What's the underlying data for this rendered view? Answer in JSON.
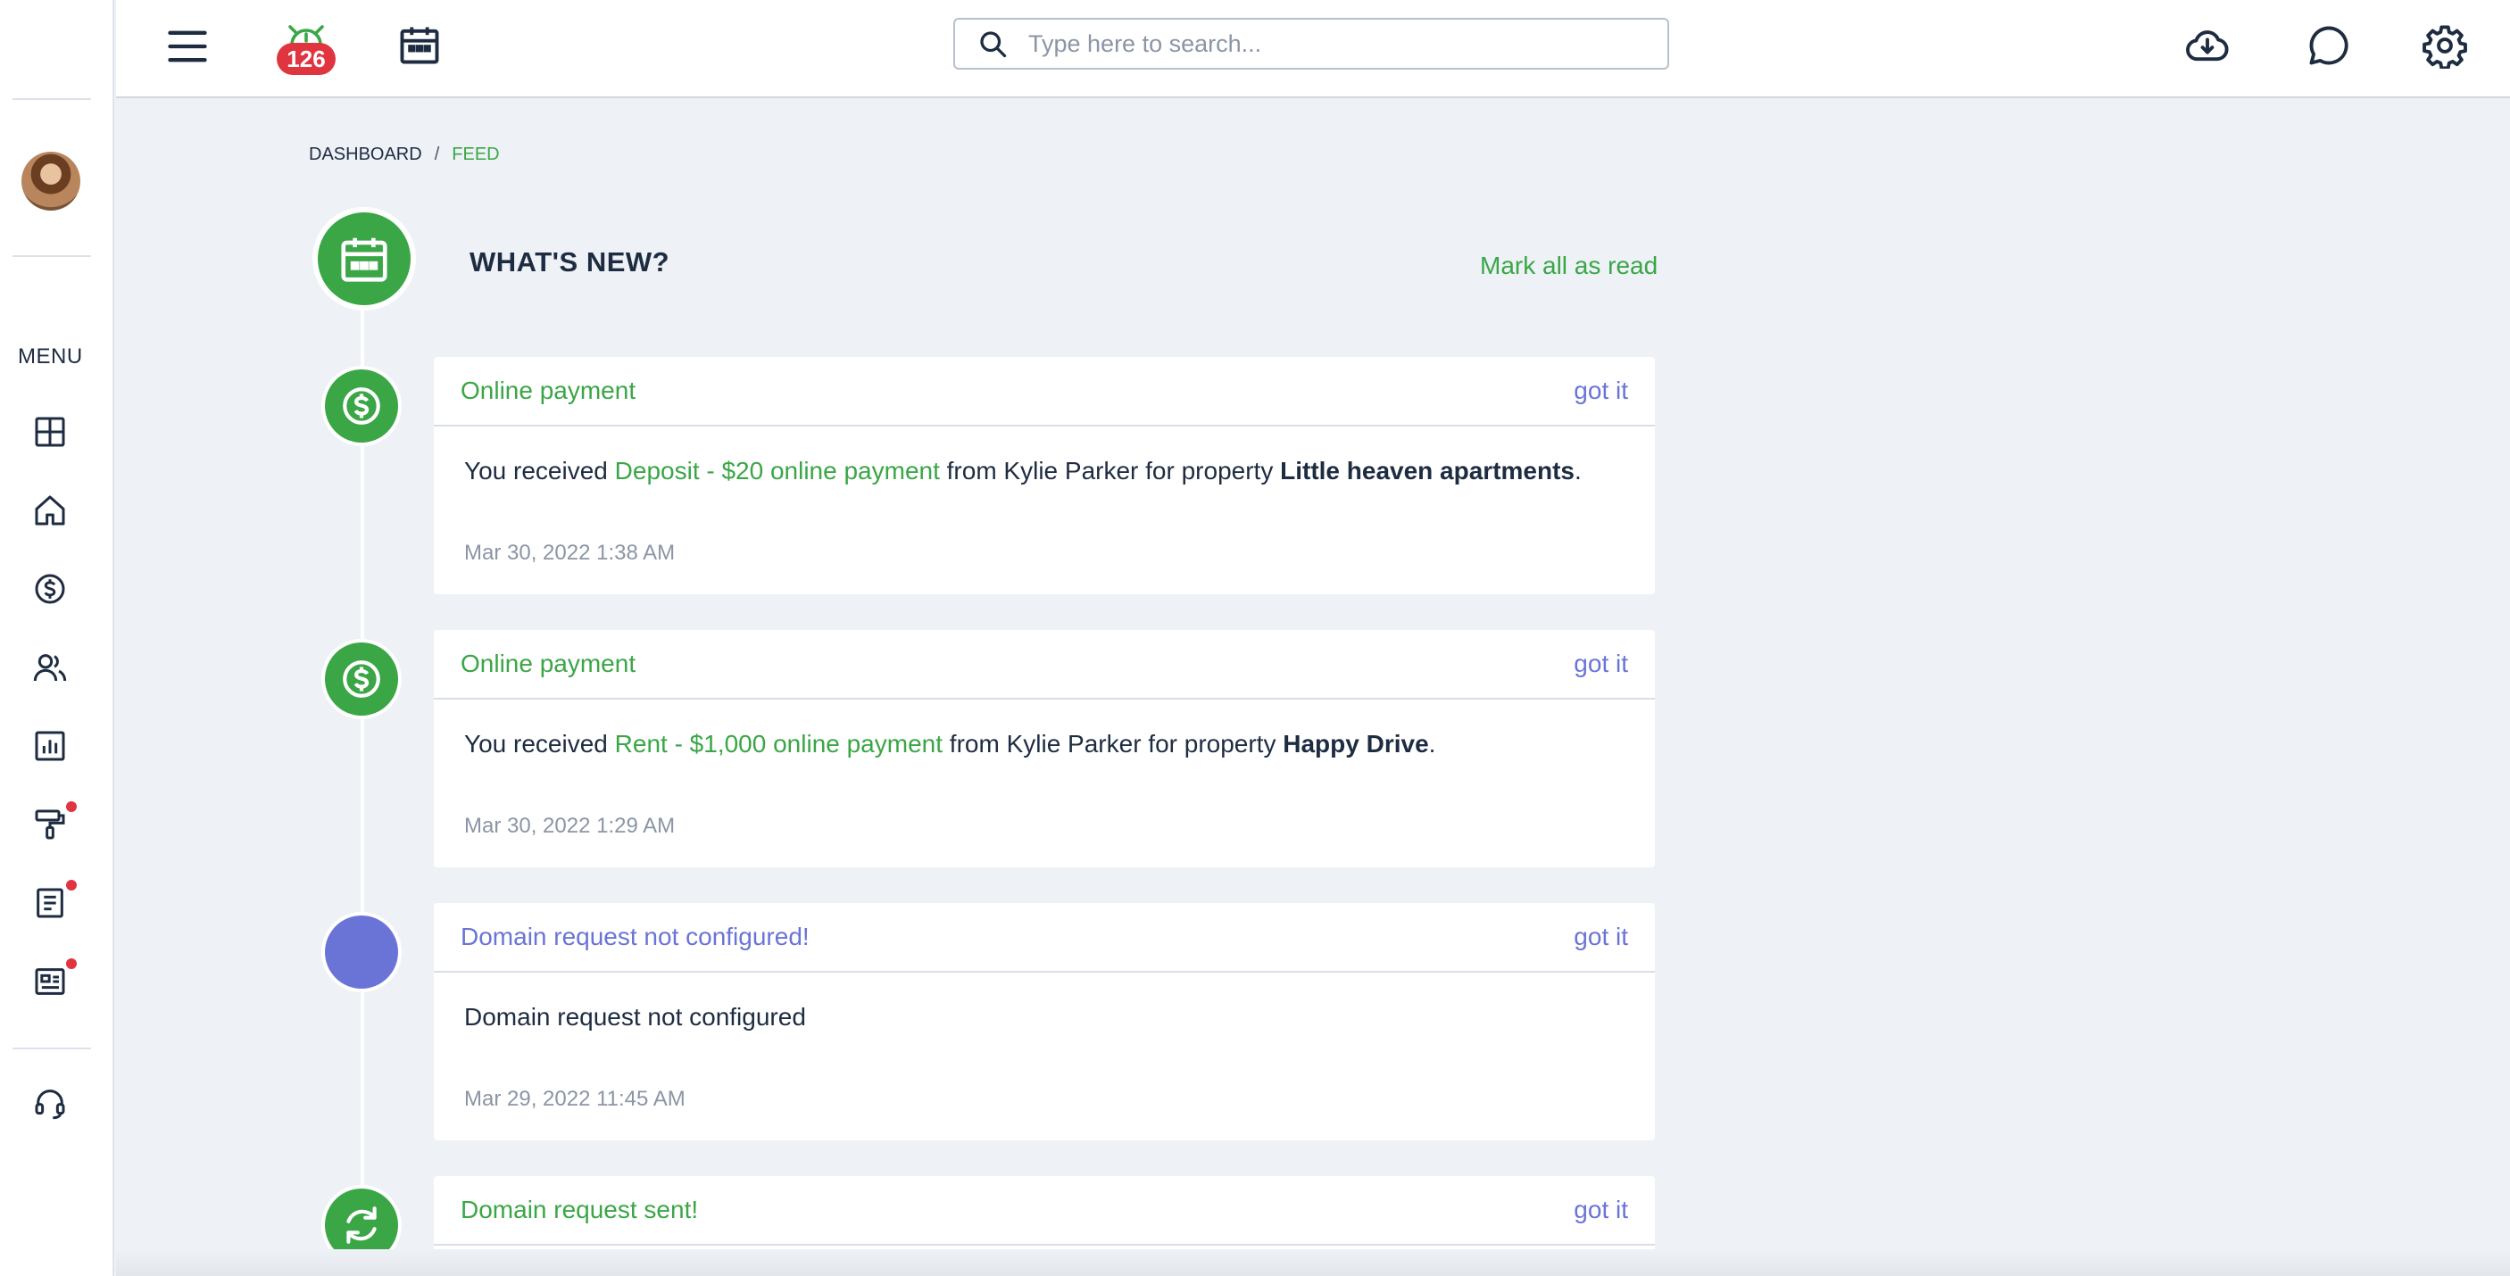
{
  "sidebar": {
    "menu_label": "MENU",
    "items": [
      {
        "icon": "dashboard-grid-icon",
        "dot": false
      },
      {
        "icon": "home-icon",
        "dot": false
      },
      {
        "icon": "dollar-circle-icon",
        "dot": false
      },
      {
        "icon": "users-icon",
        "dot": false
      },
      {
        "icon": "chart-report-icon",
        "dot": true
      },
      {
        "icon": "paint-roller-icon",
        "dot": true
      },
      {
        "icon": "document-icon",
        "dot": true
      },
      {
        "icon": "news-card-icon",
        "dot": true
      }
    ],
    "support_icon": "headset-icon"
  },
  "topbar": {
    "notification_count": "126",
    "search_placeholder": "Type here to search..."
  },
  "breadcrumb": {
    "root": "DASHBOARD",
    "separator": "/",
    "current": "FEED"
  },
  "feed": {
    "title": "WHAT'S NEW?",
    "mark_all_label": "Mark all as read",
    "got_it_label": "got it",
    "items": [
      {
        "title": "Online payment",
        "title_color": "#3aa646",
        "icon": "dollar-circle-icon",
        "body_prefix": "You received ",
        "body_highlight": "Deposit - $20 online payment",
        "body_middle": " from Kylie Parker for property ",
        "body_bold": "Little heaven apartments",
        "body_suffix": ".",
        "date": "Mar 30, 2022 1:38 AM"
      },
      {
        "title": "Online payment",
        "title_color": "#3aa646",
        "icon": "dollar-circle-icon",
        "body_prefix": "You received ",
        "body_highlight": "Rent - $1,000 online payment",
        "body_middle": " from Kylie Parker for property ",
        "body_bold": "Happy Drive",
        "body_suffix": ".",
        "date": "Mar 30, 2022 1:29 AM"
      },
      {
        "title": "Domain request not configured!",
        "title_color": "#6a74d6",
        "icon": "",
        "body_prefix": "Domain request not configured",
        "date": "Mar 29, 2022 11:45 AM"
      },
      {
        "title": "Domain request sent!",
        "title_color": "#3aa646",
        "icon": "refresh-icon"
      }
    ]
  },
  "colors": {
    "green": "#3aa646",
    "purple": "#6a74d6",
    "red": "#e0343f",
    "navy": "#1e2c42"
  }
}
